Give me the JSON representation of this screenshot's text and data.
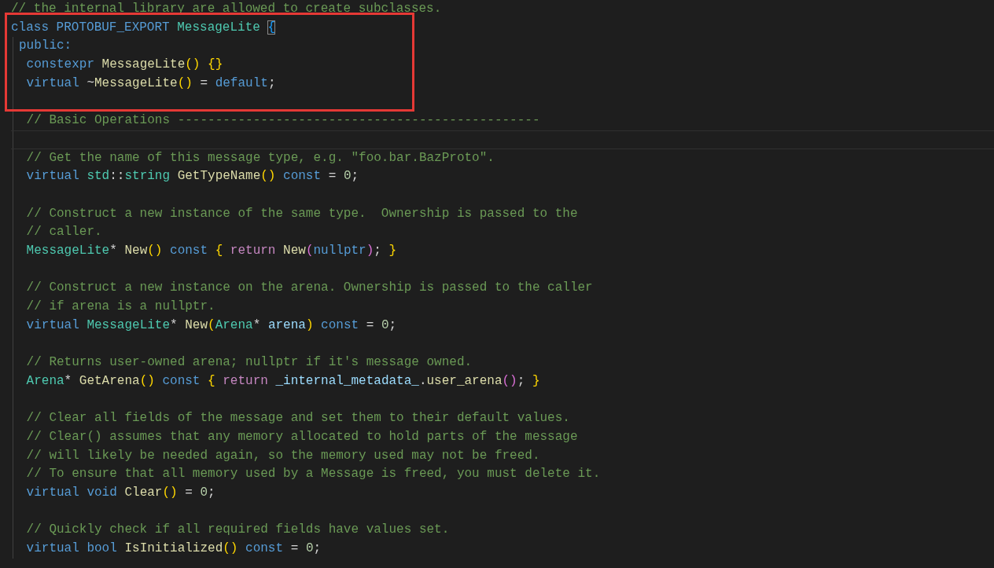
{
  "editor": {
    "lines": [
      {
        "kind": "code",
        "boxed": false,
        "tokens": [
          {
            "text": "// the internal library are allowed to create subclasses.",
            "kind": "comment"
          }
        ]
      },
      {
        "kind": "code",
        "boxed": true,
        "tokens": [
          {
            "text": "class",
            "kind": "keyword"
          },
          {
            "text": " PROTOBUF_EXPORT",
            "kind": "keyword"
          },
          {
            "text": " MessageLite ",
            "kind": "type"
          },
          {
            "text": "{",
            "kind": "matched-bracket"
          }
        ],
        "children": [
          {
            "kind": "code",
            "boxed": true,
            "tokens": [
              {
                "text": "public:",
                "kind": "keyword"
              }
            ],
            "children": [
              {
                "kind": "code",
                "boxed": true,
                "tokens": [
                  {
                    "text": "constexpr",
                    "kind": "keyword"
                  },
                  {
                    "text": " MessageLite",
                    "kind": "function"
                  },
                  {
                    "text": "() {}",
                    "kind": "bracket1"
                  }
                ]
              },
              {
                "kind": "code",
                "boxed": true,
                "tokens": [
                  {
                    "text": "virtual",
                    "kind": "keyword"
                  },
                  {
                    "text": " ~",
                    "kind": "plain"
                  },
                  {
                    "text": "MessageLite",
                    "kind": "function"
                  },
                  {
                    "text": "()",
                    "kind": "bracket1"
                  },
                  {
                    "text": " = ",
                    "kind": "plain"
                  },
                  {
                    "text": "default",
                    "kind": "keyword"
                  },
                  {
                    "text": ";",
                    "kind": "plain"
                  }
                ]
              },
              {
                "kind": "blank"
              },
              {
                "kind": "code",
                "boxed": false,
                "tokens": [
                  {
                    "text": "// Basic Operations ------------------------------------------------",
                    "kind": "comment"
                  }
                ]
              },
              {
                "kind": "current"
              },
              {
                "kind": "code",
                "boxed": false,
                "tokens": [
                  {
                    "text": "// Get the name of this message type, e.g. \"foo.bar.BazProto\".",
                    "kind": "comment"
                  }
                ]
              },
              {
                "kind": "code",
                "boxed": false,
                "tokens": [
                  {
                    "text": "virtual",
                    "kind": "keyword"
                  },
                  {
                    "text": " std",
                    "kind": "type"
                  },
                  {
                    "text": "::",
                    "kind": "plain"
                  },
                  {
                    "text": "string",
                    "kind": "type"
                  },
                  {
                    "text": " GetTypeName",
                    "kind": "function"
                  },
                  {
                    "text": "()",
                    "kind": "bracket1"
                  },
                  {
                    "text": " const",
                    "kind": "keyword"
                  },
                  {
                    "text": " = ",
                    "kind": "plain"
                  },
                  {
                    "text": "0",
                    "kind": "number"
                  },
                  {
                    "text": ";",
                    "kind": "plain"
                  }
                ]
              },
              {
                "kind": "blank"
              },
              {
                "kind": "code",
                "boxed": false,
                "tokens": [
                  {
                    "text": "// Construct a new instance of the same type.  Ownership is passed to the",
                    "kind": "comment"
                  }
                ]
              },
              {
                "kind": "code",
                "boxed": false,
                "tokens": [
                  {
                    "text": "// caller.",
                    "kind": "comment"
                  }
                ]
              },
              {
                "kind": "code",
                "boxed": false,
                "tokens": [
                  {
                    "text": "MessageLite",
                    "kind": "type"
                  },
                  {
                    "text": "* ",
                    "kind": "plain"
                  },
                  {
                    "text": "New",
                    "kind": "function"
                  },
                  {
                    "text": "()",
                    "kind": "bracket1"
                  },
                  {
                    "text": " const",
                    "kind": "keyword"
                  },
                  {
                    "text": " {",
                    "kind": "bracket1"
                  },
                  {
                    "text": " return",
                    "kind": "control"
                  },
                  {
                    "text": " New",
                    "kind": "function"
                  },
                  {
                    "text": "(",
                    "kind": "bracket2"
                  },
                  {
                    "text": "nullptr",
                    "kind": "keyword"
                  },
                  {
                    "text": ")",
                    "kind": "bracket2"
                  },
                  {
                    "text": ";",
                    "kind": "plain"
                  },
                  {
                    "text": " }",
                    "kind": "bracket1"
                  }
                ]
              },
              {
                "kind": "blank"
              },
              {
                "kind": "code",
                "boxed": false,
                "tokens": [
                  {
                    "text": "// Construct a new instance on the arena. Ownership is passed to the caller",
                    "kind": "comment"
                  }
                ]
              },
              {
                "kind": "code",
                "boxed": false,
                "tokens": [
                  {
                    "text": "// if arena is a nullptr.",
                    "kind": "comment"
                  }
                ]
              },
              {
                "kind": "code",
                "boxed": false,
                "tokens": [
                  {
                    "text": "virtual",
                    "kind": "keyword"
                  },
                  {
                    "text": " MessageLite",
                    "kind": "type"
                  },
                  {
                    "text": "* ",
                    "kind": "plain"
                  },
                  {
                    "text": "New",
                    "kind": "function"
                  },
                  {
                    "text": "(",
                    "kind": "bracket1"
                  },
                  {
                    "text": "Arena",
                    "kind": "type"
                  },
                  {
                    "text": "* ",
                    "kind": "plain"
                  },
                  {
                    "text": "arena",
                    "kind": "variable"
                  },
                  {
                    "text": ")",
                    "kind": "bracket1"
                  },
                  {
                    "text": " const",
                    "kind": "keyword"
                  },
                  {
                    "text": " = ",
                    "kind": "plain"
                  },
                  {
                    "text": "0",
                    "kind": "number"
                  },
                  {
                    "text": ";",
                    "kind": "plain"
                  }
                ]
              },
              {
                "kind": "blank"
              },
              {
                "kind": "code",
                "boxed": false,
                "tokens": [
                  {
                    "text": "// Returns user-owned arena; nullptr if it's message owned.",
                    "kind": "comment"
                  }
                ]
              },
              {
                "kind": "code",
                "boxed": false,
                "tokens": [
                  {
                    "text": "Arena",
                    "kind": "type"
                  },
                  {
                    "text": "* ",
                    "kind": "plain"
                  },
                  {
                    "text": "GetArena",
                    "kind": "function"
                  },
                  {
                    "text": "()",
                    "kind": "bracket1"
                  },
                  {
                    "text": " const",
                    "kind": "keyword"
                  },
                  {
                    "text": " {",
                    "kind": "bracket1"
                  },
                  {
                    "text": " return",
                    "kind": "control"
                  },
                  {
                    "text": " _internal_metadata_",
                    "kind": "variable"
                  },
                  {
                    "text": ".",
                    "kind": "plain"
                  },
                  {
                    "text": "user_arena",
                    "kind": "function"
                  },
                  {
                    "text": "()",
                    "kind": "bracket2"
                  },
                  {
                    "text": ";",
                    "kind": "plain"
                  },
                  {
                    "text": " }",
                    "kind": "bracket1"
                  }
                ]
              },
              {
                "kind": "blank"
              },
              {
                "kind": "code",
                "boxed": false,
                "tokens": [
                  {
                    "text": "// Clear all fields of the message and set them to their default values.",
                    "kind": "comment"
                  }
                ]
              },
              {
                "kind": "code",
                "boxed": false,
                "tokens": [
                  {
                    "text": "// Clear() assumes that any memory allocated to hold parts of the message",
                    "kind": "comment"
                  }
                ]
              },
              {
                "kind": "code",
                "boxed": false,
                "tokens": [
                  {
                    "text": "// will likely be needed again, so the memory used may not be freed.",
                    "kind": "comment"
                  }
                ]
              },
              {
                "kind": "code",
                "boxed": false,
                "tokens": [
                  {
                    "text": "// To ensure that all memory used by a Message is freed, you must delete it.",
                    "kind": "comment"
                  }
                ]
              },
              {
                "kind": "code",
                "boxed": false,
                "tokens": [
                  {
                    "text": "virtual",
                    "kind": "keyword"
                  },
                  {
                    "text": " void",
                    "kind": "keyword"
                  },
                  {
                    "text": " Clear",
                    "kind": "function"
                  },
                  {
                    "text": "()",
                    "kind": "bracket1"
                  },
                  {
                    "text": " = ",
                    "kind": "plain"
                  },
                  {
                    "text": "0",
                    "kind": "number"
                  },
                  {
                    "text": ";",
                    "kind": "plain"
                  }
                ]
              },
              {
                "kind": "blank"
              },
              {
                "kind": "code",
                "boxed": false,
                "tokens": [
                  {
                    "text": "// Quickly check if all required fields have values set.",
                    "kind": "comment"
                  }
                ]
              },
              {
                "kind": "code",
                "boxed": false,
                "tokens": [
                  {
                    "text": "virtual",
                    "kind": "keyword"
                  },
                  {
                    "text": " bool",
                    "kind": "keyword"
                  },
                  {
                    "text": " IsInitialized",
                    "kind": "function"
                  },
                  {
                    "text": "()",
                    "kind": "bracket1"
                  },
                  {
                    "text": " const",
                    "kind": "keyword"
                  },
                  {
                    "text": " = ",
                    "kind": "plain"
                  },
                  {
                    "text": "0",
                    "kind": "number"
                  },
                  {
                    "text": ";",
                    "kind": "plain"
                  }
                ]
              }
            ]
          }
        ]
      }
    ]
  }
}
